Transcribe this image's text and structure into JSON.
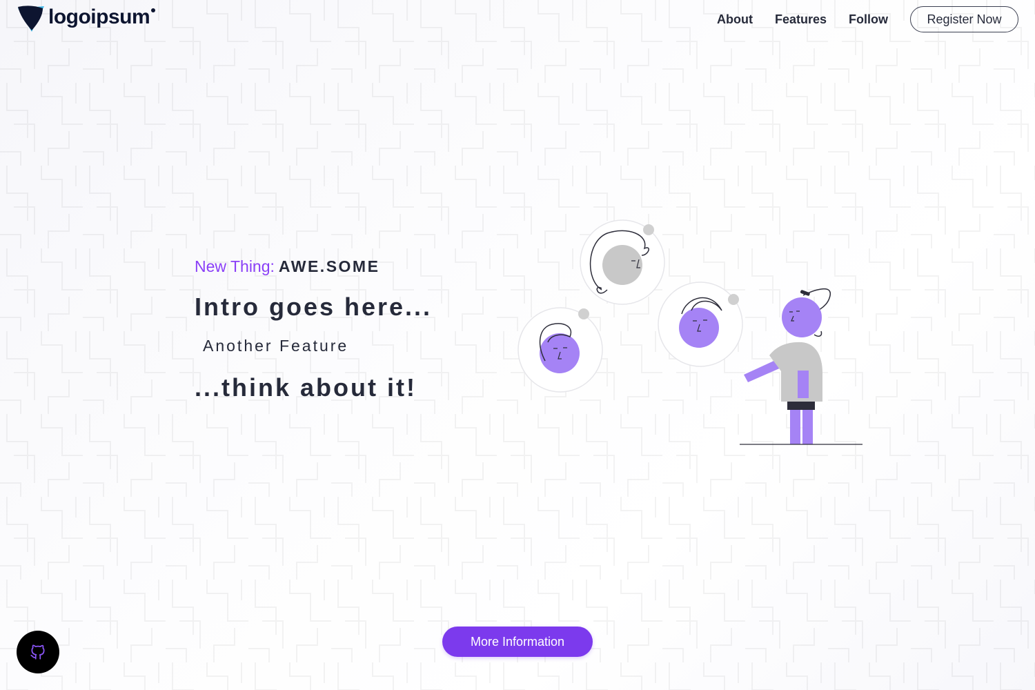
{
  "header": {
    "logo_text": "logoipsum",
    "nav": [
      {
        "label": "About"
      },
      {
        "label": "Features"
      },
      {
        "label": "Follow"
      }
    ],
    "register_label": "Register Now"
  },
  "hero": {
    "kicker_label": "New Thing:",
    "kicker_value": "AWE.SOME",
    "intro": "Intro goes here...",
    "feature": "Another Feature",
    "closing": "...think about it!"
  },
  "cta": {
    "more_label": "More Information"
  },
  "icons": {
    "logo": "logo-mark-icon",
    "github": "github-icon"
  },
  "colors": {
    "accent": "#7c3aed",
    "accent_light": "#a583f5",
    "text": "#262a3a",
    "logo_navy": "#0d1530",
    "logo_cyan": "#3fb7e8",
    "github_bg": "#000000"
  }
}
